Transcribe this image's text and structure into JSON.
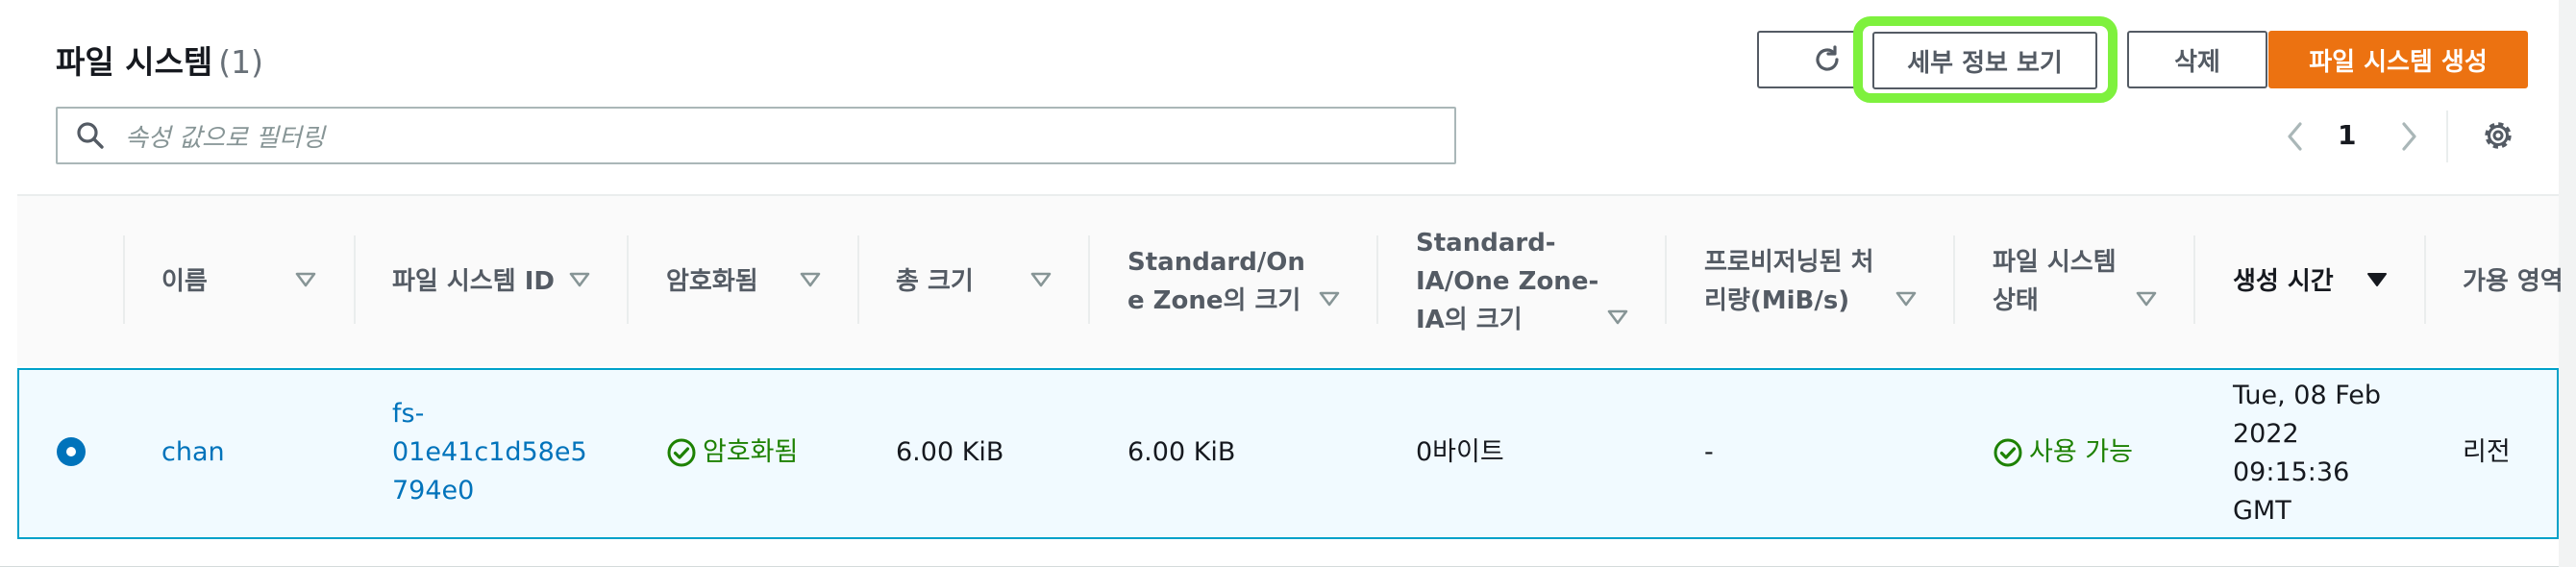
{
  "header": {
    "title": "파일 시스템",
    "count": "(1)"
  },
  "toolbar": {
    "refresh_icon": "refresh-icon",
    "details_label": "세부 정보 보기",
    "delete_label": "삭제",
    "create_label": "파일 시스템 생성"
  },
  "search": {
    "placeholder": "속성 값으로 필터링",
    "icon": "search-icon"
  },
  "pagination": {
    "current_page": "1",
    "prev_icon": "chevron-left-icon",
    "next_icon": "chevron-right-icon",
    "settings_icon": "gear-icon"
  },
  "table": {
    "columns": [
      {
        "key": "name",
        "lines": [
          "이름"
        ]
      },
      {
        "key": "id",
        "lines": [
          "파일 시스템 ID"
        ]
      },
      {
        "key": "encrypted",
        "lines": [
          "암호화됨"
        ]
      },
      {
        "key": "total_size",
        "lines": [
          "총 크기"
        ]
      },
      {
        "key": "standard_size",
        "lines": [
          "Standard/On",
          "e Zone의 크기"
        ]
      },
      {
        "key": "ia_size",
        "lines": [
          "Standard-",
          "IA/One Zone-",
          "IA의 크기"
        ]
      },
      {
        "key": "throughput",
        "lines": [
          "프로비저닝된 처",
          "리량(MiB/s)"
        ]
      },
      {
        "key": "state",
        "lines": [
          "파일 시스템",
          "상태"
        ]
      },
      {
        "key": "created",
        "lines": [
          "생성 시간"
        ]
      },
      {
        "key": "az",
        "lines": [
          "가용 영역"
        ]
      }
    ],
    "rows": [
      {
        "name": "chan",
        "id_lines": [
          "fs-",
          "01e41c1d58e5",
          "794e0"
        ],
        "encrypted": "암호화됨",
        "total_size": "6.00 KiB",
        "standard_size": "6.00 KiB",
        "ia_size": "0바이트",
        "throughput": "-",
        "state": "사용 가능",
        "created_lines": [
          "Tue, 08 Feb",
          "2022",
          "09:15:36",
          "GMT"
        ],
        "az": "리전"
      }
    ]
  },
  "colors": {
    "primary": "#ec7211",
    "link": "#0073bb",
    "success": "#1d8102",
    "highlight": "#7ef13e",
    "selected_row": "#f1faff"
  }
}
